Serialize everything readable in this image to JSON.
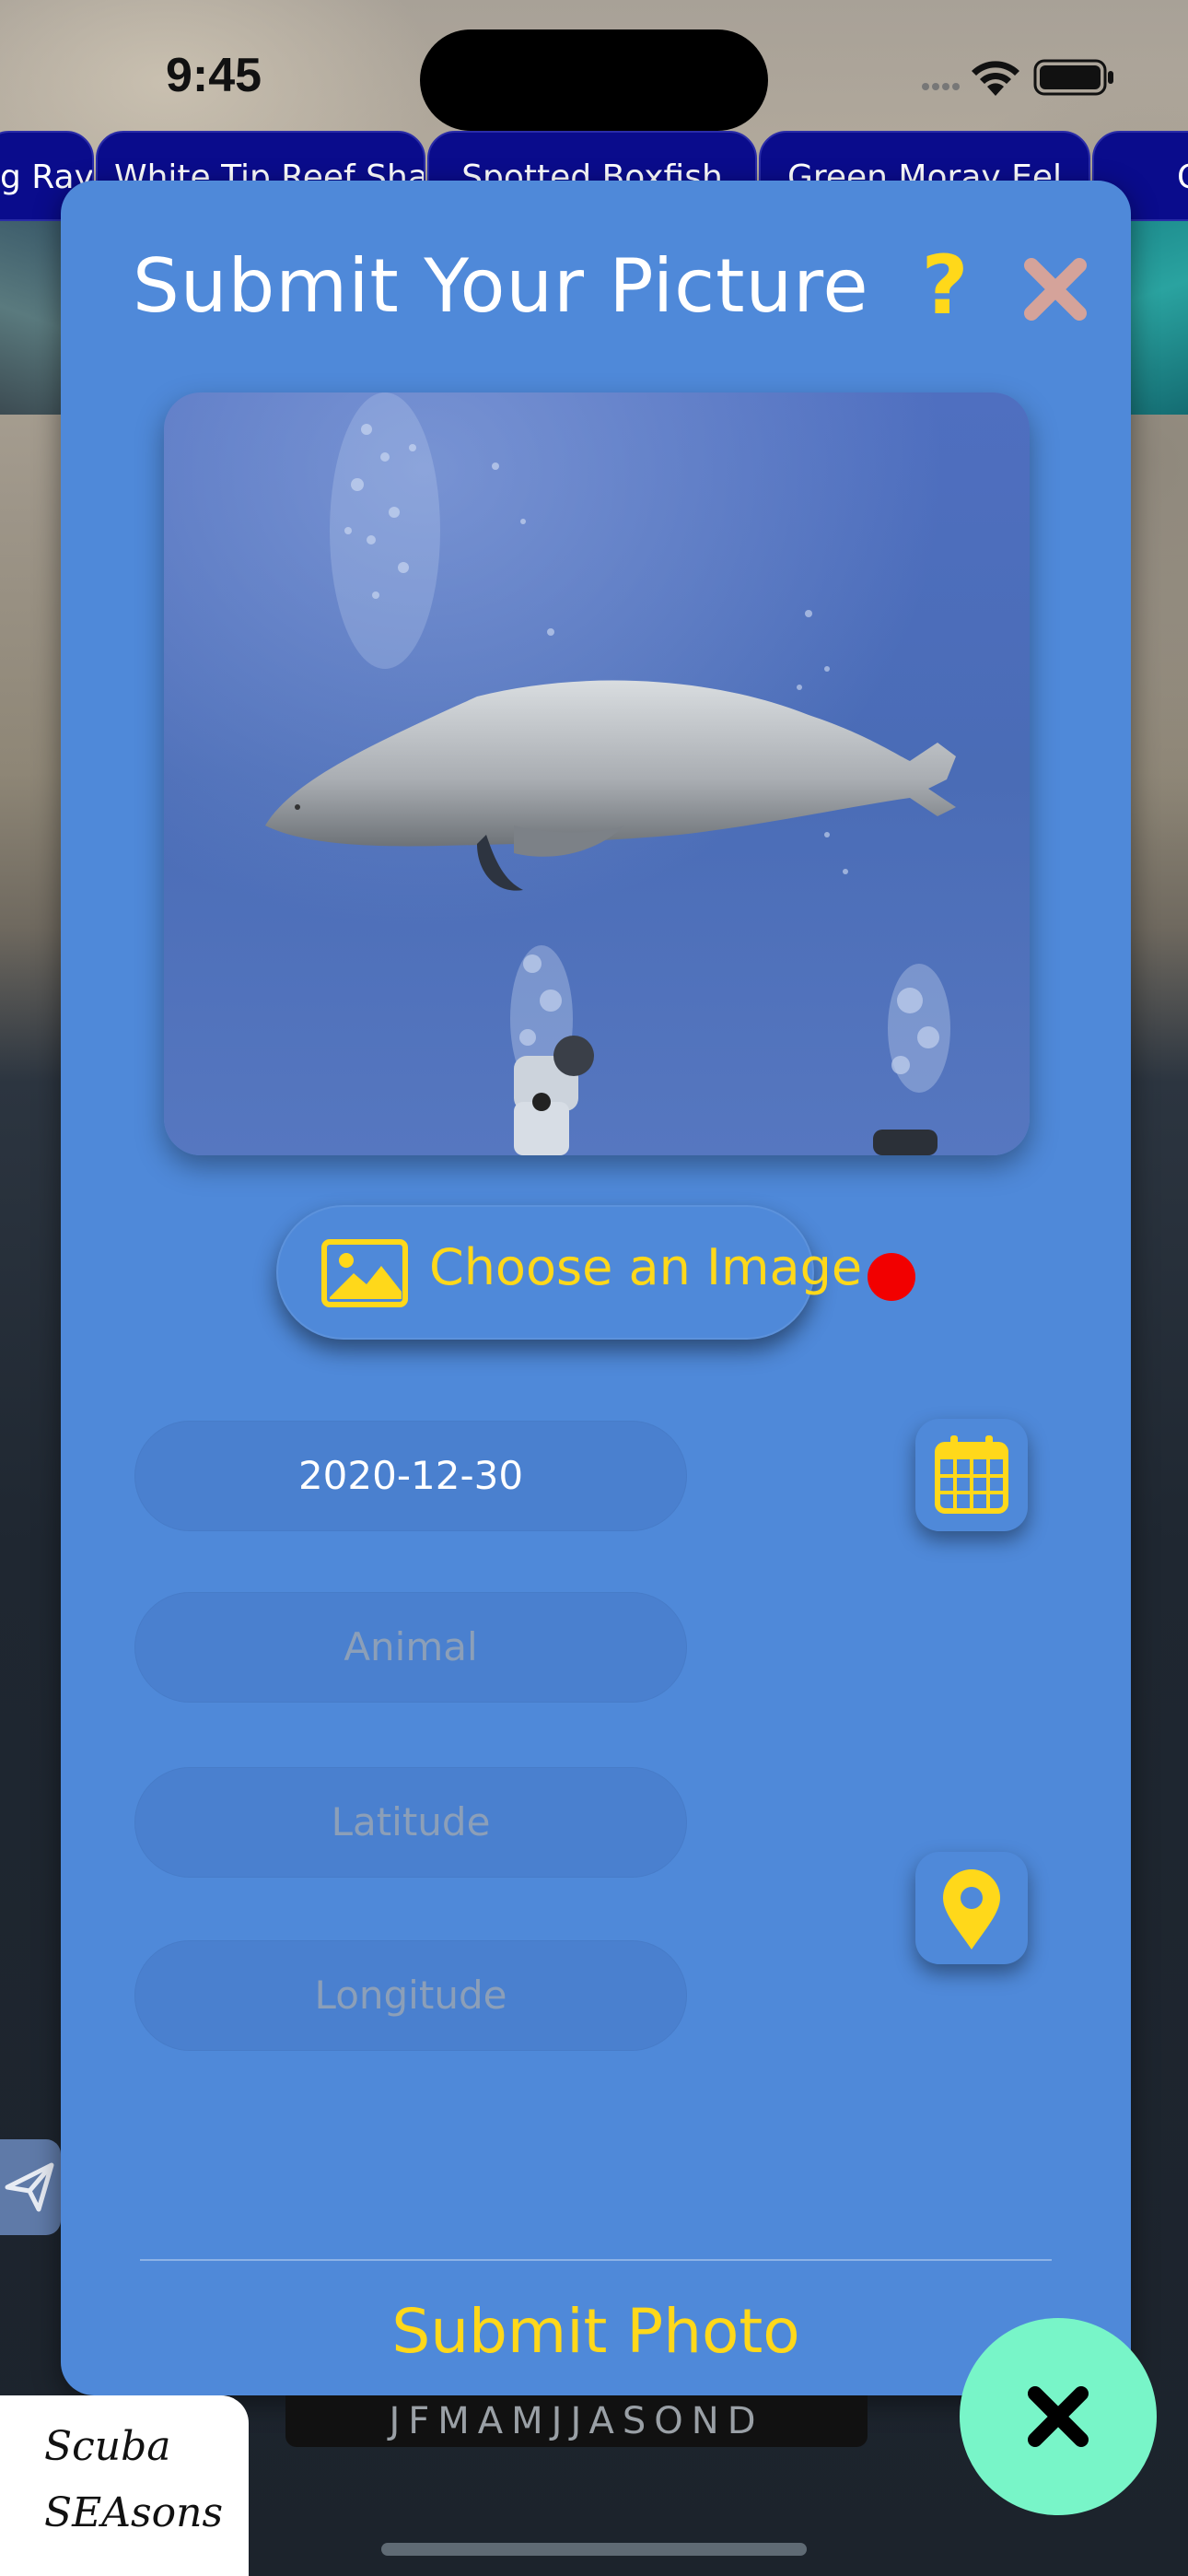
{
  "status_bar": {
    "time": "9:45"
  },
  "species_tabs": [
    {
      "label": "g Ray"
    },
    {
      "label": "White Tip Reef Shark"
    },
    {
      "label": "Spotted Boxfish"
    },
    {
      "label": "Green Moray Eel"
    },
    {
      "label": "C"
    }
  ],
  "modal": {
    "title": "Submit Your Picture",
    "help_label": "?",
    "choose_image_label": "Choose an Image",
    "date_value": "2020-12-30",
    "animal_placeholder": "Animal",
    "latitude_placeholder": "Latitude",
    "longitude_placeholder": "Longitude",
    "submit_label": "Submit Photo",
    "accent_color": "#ffd81a",
    "status_dot_color": "#f20000",
    "photo_subject": "monk seal swimming above a scuba diver"
  },
  "bottom": {
    "brand_line1": "Scuba",
    "brand_line2": "SEAsons",
    "months": "JFMAMJJASOND"
  },
  "icons": {
    "help": "question-mark-icon",
    "close": "close-icon",
    "choose": "image-icon",
    "calendar": "calendar-icon",
    "location": "map-pin-icon",
    "send": "send-icon",
    "fab": "close-icon"
  }
}
